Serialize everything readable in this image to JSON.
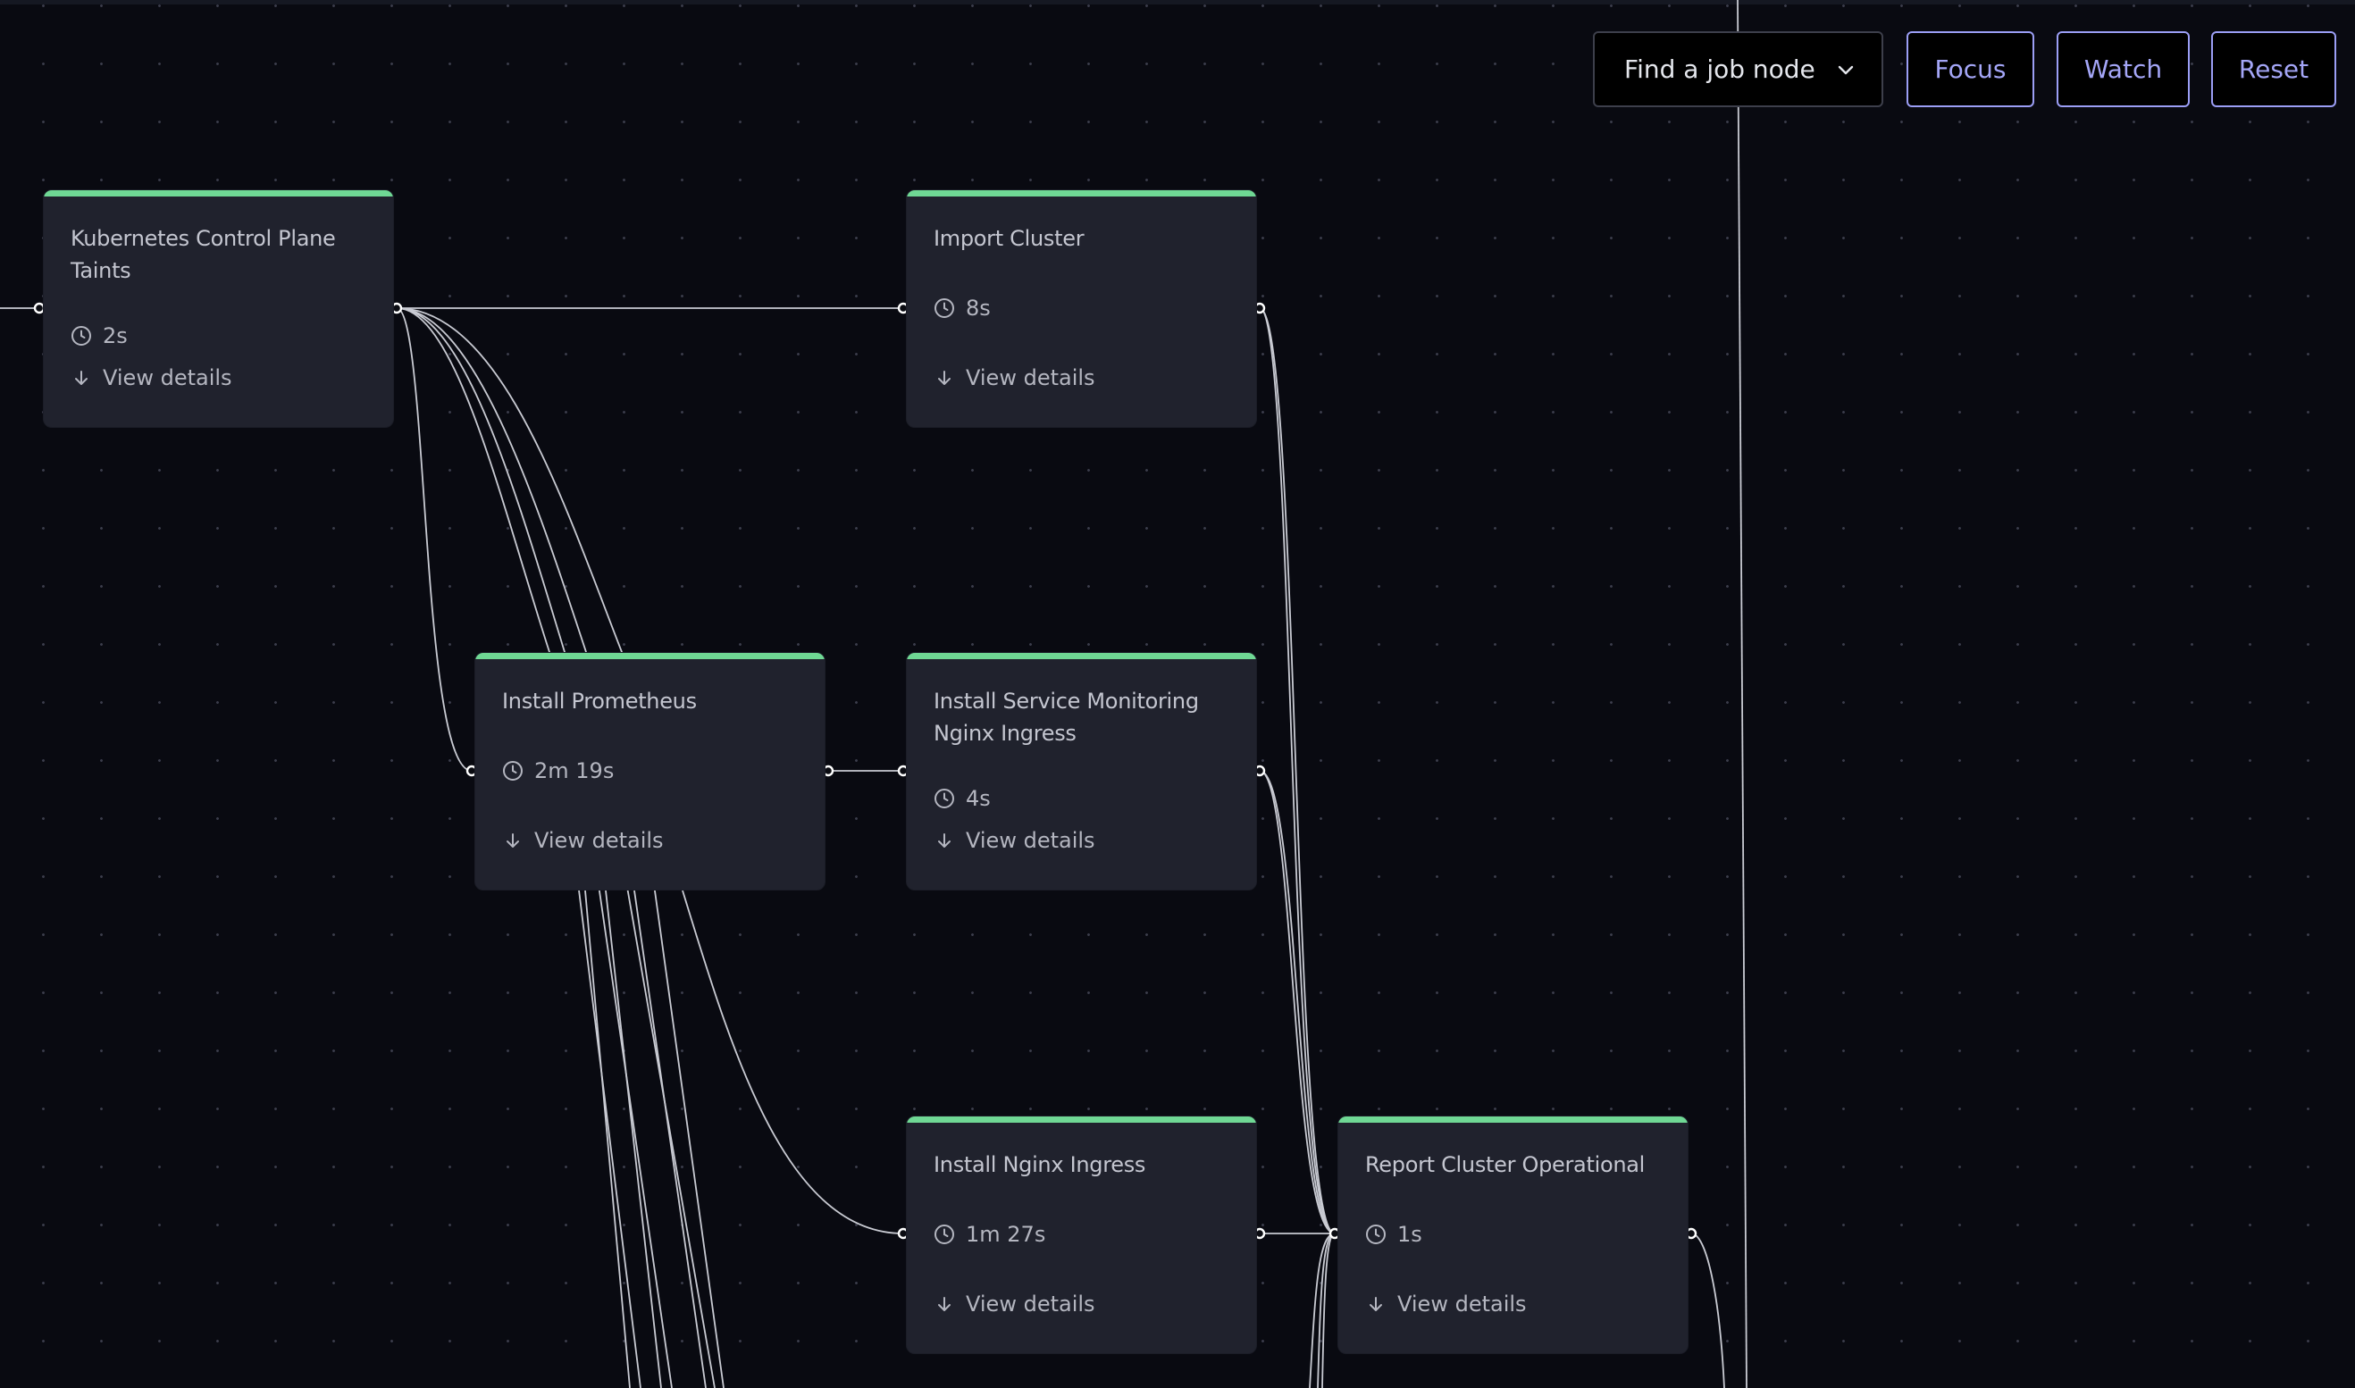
{
  "controls": {
    "job_select": {
      "label": "Find a job node",
      "icon": "chevron-down-icon"
    },
    "focus_label": "Focus",
    "watch_label": "Watch",
    "reset_label": "Reset",
    "accent_color": "#9b9ef5"
  },
  "status_colors": {
    "success": "#6fd894"
  },
  "nodes": [
    {
      "id": "k8s-taints",
      "title": "Kubernetes Control Plane Taints",
      "duration": "2s",
      "details_label": "View details",
      "status": "success"
    },
    {
      "id": "import-cluster",
      "title": "Import Cluster",
      "duration": "8s",
      "details_label": "View details",
      "status": "success"
    },
    {
      "id": "install-prometheus",
      "title": "Install Prometheus",
      "duration": "2m 19s",
      "details_label": "View details",
      "status": "success"
    },
    {
      "id": "install-svc-monitoring",
      "title": "Install Service Monitoring Nginx Ingress",
      "duration": "4s",
      "details_label": "View details",
      "status": "success"
    },
    {
      "id": "install-nginx",
      "title": "Install Nginx Ingress",
      "duration": "1m 27s",
      "details_label": "View details",
      "status": "success"
    },
    {
      "id": "report-operational",
      "title": "Report Cluster Operational",
      "duration": "1s",
      "details_label": "View details",
      "status": "success"
    }
  ],
  "edges": [
    {
      "from": "k8s-taints",
      "to": "import-cluster"
    },
    {
      "from": "k8s-taints",
      "to": "install-prometheus"
    },
    {
      "from": "install-prometheus",
      "to": "install-svc-monitoring"
    },
    {
      "from": "install-prometheus",
      "to": "install-nginx"
    },
    {
      "from": "install-nginx",
      "to": "report-operational"
    },
    {
      "from": "import-cluster",
      "to": "report-operational"
    },
    {
      "from": "install-svc-monitoring",
      "to": "report-operational"
    }
  ]
}
